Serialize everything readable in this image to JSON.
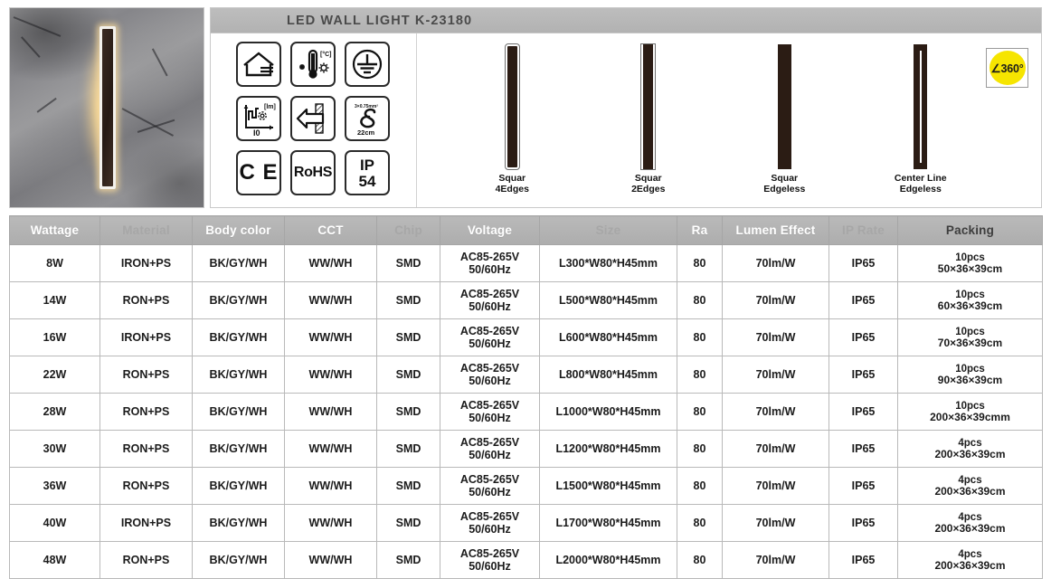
{
  "product": {
    "title": "LED WALL LIGHT  K-23180",
    "photo_alt": "led-wall-light-on-stone-wall"
  },
  "certifications": {
    "ce_label": "C E",
    "rohs_label": "RoHS",
    "ip_label": "IP",
    "ip_value": "54"
  },
  "icon_specs": {
    "indoor_mount_label": "indoor-wall-mount-icon",
    "temperature_label": "[°C]",
    "earth_label": "protective-earth-icon",
    "lumen_axis_label": "[lm]",
    "lumen_value": "I0",
    "wall_fix_label": "wall-fixing-arrow-icon",
    "cable_gauge_label": "3×0.75mm²",
    "cable_length": "22cm"
  },
  "variants": [
    {
      "line1": "Squar",
      "line2": "4Edges",
      "style": "e4"
    },
    {
      "line1": "Squar",
      "line2": "2Edges",
      "style": "e2"
    },
    {
      "line1": "Squar",
      "line2": "Edgeless",
      "style": "e0"
    },
    {
      "line1": "Center Line",
      "line2": "Edgeless",
      "style": "ec"
    }
  ],
  "beam_badge": {
    "text": "∠360°",
    "color": "#f6e500"
  },
  "table": {
    "headers": [
      {
        "label": "Wattage",
        "faded": false
      },
      {
        "label": "Material",
        "faded": true
      },
      {
        "label": "Body color",
        "faded": false
      },
      {
        "label": "CCT",
        "faded": false
      },
      {
        "label": "Chip",
        "faded": true
      },
      {
        "label": "Voltage",
        "faded": false
      },
      {
        "label": "Size",
        "faded": true
      },
      {
        "label": "Ra",
        "faded": false
      },
      {
        "label": "Lumen Effect",
        "faded": false
      },
      {
        "label": "IP Rate",
        "faded": true
      },
      {
        "label": "Packing",
        "faded": false,
        "dark": true
      }
    ],
    "rows": [
      {
        "wattage": "8W",
        "material": "IRON+PS",
        "body_color": "BK/GY/WH",
        "cct": "WW/WH",
        "chip": "SMD",
        "voltage_line1": "AC85-265V",
        "voltage_line2": "50/60Hz",
        "size": "L300*W80*H45mm",
        "ra": "80",
        "lumen": "70lm/W",
        "ip_rate": "IP65",
        "packing_qty": "10pcs",
        "packing_dim": "50×36×39cm"
      },
      {
        "wattage": "14W",
        "material": "RON+PS",
        "body_color": "BK/GY/WH",
        "cct": "WW/WH",
        "chip": "SMD",
        "voltage_line1": "AC85-265V",
        "voltage_line2": "50/60Hz",
        "size": "L500*W80*H45mm",
        "ra": "80",
        "lumen": "70lm/W",
        "ip_rate": "IP65",
        "packing_qty": "10pcs",
        "packing_dim": "60×36×39cm"
      },
      {
        "wattage": "16W",
        "material": "IRON+PS",
        "body_color": "BK/GY/WH",
        "cct": "WW/WH",
        "chip": "SMD",
        "voltage_line1": "AC85-265V",
        "voltage_line2": "50/60Hz",
        "size": "L600*W80*H45mm",
        "ra": "80",
        "lumen": "70lm/W",
        "ip_rate": "IP65",
        "packing_qty": "10pcs",
        "packing_dim": "70×36×39cm"
      },
      {
        "wattage": "22W",
        "material": "RON+PS",
        "body_color": "BK/GY/WH",
        "cct": "WW/WH",
        "chip": "SMD",
        "voltage_line1": "AC85-265V",
        "voltage_line2": "50/60Hz",
        "size": "L800*W80*H45mm",
        "ra": "80",
        "lumen": "70lm/W",
        "ip_rate": "IP65",
        "packing_qty": "10pcs",
        "packing_dim": "90×36×39cm"
      },
      {
        "wattage": "28W",
        "material": "RON+PS",
        "body_color": "BK/GY/WH",
        "cct": "WW/WH",
        "chip": "SMD",
        "voltage_line1": "AC85-265V",
        "voltage_line2": "50/60Hz",
        "size": "L1000*W80*H45mm",
        "ra": "80",
        "lumen": "70lm/W",
        "ip_rate": "IP65",
        "packing_qty": "10pcs",
        "packing_dim": "200×36×39cmm"
      },
      {
        "wattage": "30W",
        "material": "RON+PS",
        "body_color": "BK/GY/WH",
        "cct": "WW/WH",
        "chip": "SMD",
        "voltage_line1": "AC85-265V",
        "voltage_line2": "50/60Hz",
        "size": "L1200*W80*H45mm",
        "ra": "80",
        "lumen": "70lm/W",
        "ip_rate": "IP65",
        "packing_qty": "4pcs",
        "packing_dim": "200×36×39cm"
      },
      {
        "wattage": "36W",
        "material": "RON+PS",
        "body_color": "BK/GY/WH",
        "cct": "WW/WH",
        "chip": "SMD",
        "voltage_line1": "AC85-265V",
        "voltage_line2": "50/60Hz",
        "size": "L1500*W80*H45mm",
        "ra": "80",
        "lumen": "70lm/W",
        "ip_rate": "IP65",
        "packing_qty": "4pcs",
        "packing_dim": "200×36×39cm"
      },
      {
        "wattage": "40W",
        "material": "IRON+PS",
        "body_color": "BK/GY/WH",
        "cct": "WW/WH",
        "chip": "SMD",
        "voltage_line1": "AC85-265V",
        "voltage_line2": "50/60Hz",
        "size": "L1700*W80*H45mm",
        "ra": "80",
        "lumen": "70lm/W",
        "ip_rate": "IP65",
        "packing_qty": "4pcs",
        "packing_dim": "200×36×39cm"
      },
      {
        "wattage": "48W",
        "material": "RON+PS",
        "body_color": "BK/GY/WH",
        "cct": "WW/WH",
        "chip": "SMD",
        "voltage_line1": "AC85-265V",
        "voltage_line2": "50/60Hz",
        "size": "L2000*W80*H45mm",
        "ra": "80",
        "lumen": "70lm/W",
        "ip_rate": "IP65",
        "packing_qty": "4pcs",
        "packing_dim": "200×36×39cm"
      }
    ]
  }
}
